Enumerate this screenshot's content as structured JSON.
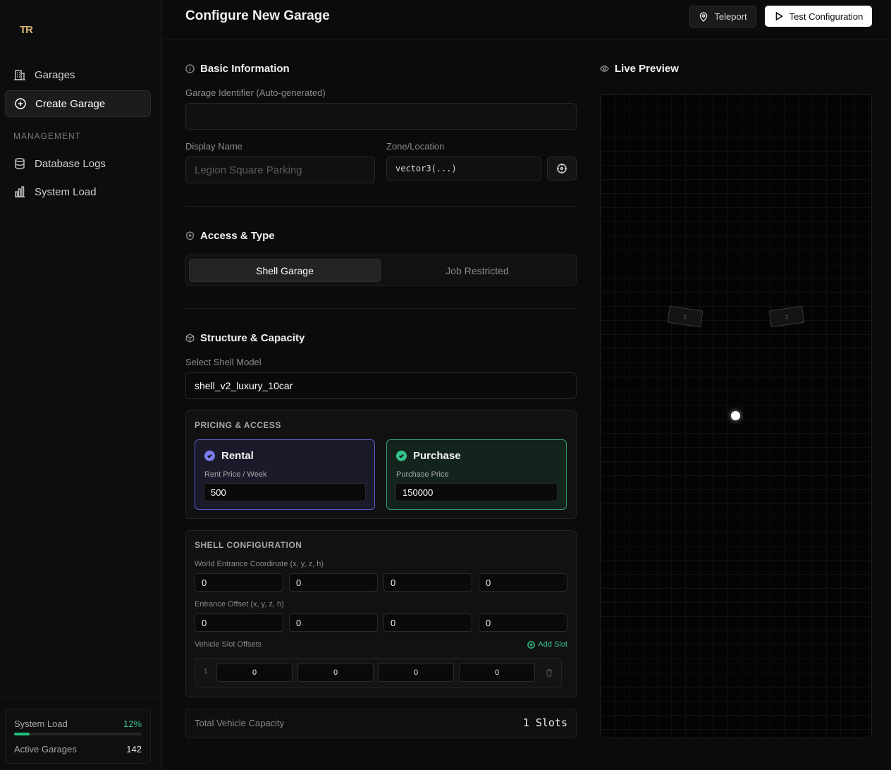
{
  "sidebar": {
    "logo": "TR",
    "items": [
      {
        "label": "Garages",
        "icon": "building-icon"
      },
      {
        "label": "Create Garage",
        "icon": "plus-circle-icon"
      }
    ],
    "section_label": "MANAGEMENT",
    "management_items": [
      {
        "label": "Database Logs",
        "icon": "database-icon"
      },
      {
        "label": "System Load",
        "icon": "bar-chart-icon"
      }
    ],
    "stats": {
      "system_load_label": "System Load",
      "system_load_value": "12%",
      "system_load_fraction": 0.12,
      "active_garages_label": "Active Garages",
      "active_garages_value": "142"
    }
  },
  "header": {
    "title": "Configure New Garage",
    "teleport_label": "Teleport",
    "test_label": "Test Configuration"
  },
  "basic": {
    "title": "Basic Information",
    "identifier_label": "Garage Identifier (Auto-generated)",
    "identifier_value": "",
    "display_name_label": "Display Name",
    "display_name_placeholder": "Legion Square Parking",
    "zone_label": "Zone/Location",
    "zone_value": "vector3(...)"
  },
  "access": {
    "title": "Access & Type",
    "options": [
      "Shell Garage",
      "Job Restricted"
    ],
    "selected": "Shell Garage"
  },
  "structure": {
    "title": "Structure & Capacity",
    "shell_label": "Select Shell Model",
    "shell_value": "shell_v2_luxury_10car"
  },
  "pricing": {
    "title": "PRICING & ACCESS",
    "rental": {
      "label": "Rental",
      "field_label": "Rent Price / Week",
      "value": "500"
    },
    "purchase": {
      "label": "Purchase",
      "field_label": "Purchase Price",
      "value": "150000"
    }
  },
  "shell_config": {
    "title": "SHELL CONFIGURATION",
    "world_entrance_label": "World Entrance Coordinate (x, y, z, h)",
    "world_entrance": [
      "0",
      "0",
      "0",
      "0"
    ],
    "entrance_offset_label": "Entrance Offset (x, y, z, h)",
    "entrance_offset": [
      "0",
      "0",
      "0",
      "0"
    ],
    "slot_offsets_label": "Vehicle Slot Offsets",
    "add_slot_label": "Add Slot",
    "slots": [
      {
        "index": "1",
        "values": [
          "0",
          "0",
          "0",
          "0"
        ]
      }
    ]
  },
  "total": {
    "label": "Total Vehicle Capacity",
    "value": "1 Slots"
  },
  "preview": {
    "title": "Live Preview",
    "slot_labels": [
      "1",
      "2"
    ]
  },
  "colors": {
    "accent_green": "#36c28b",
    "accent_purple": "#7c7cf0",
    "brand_gold": "#d9b26f"
  }
}
